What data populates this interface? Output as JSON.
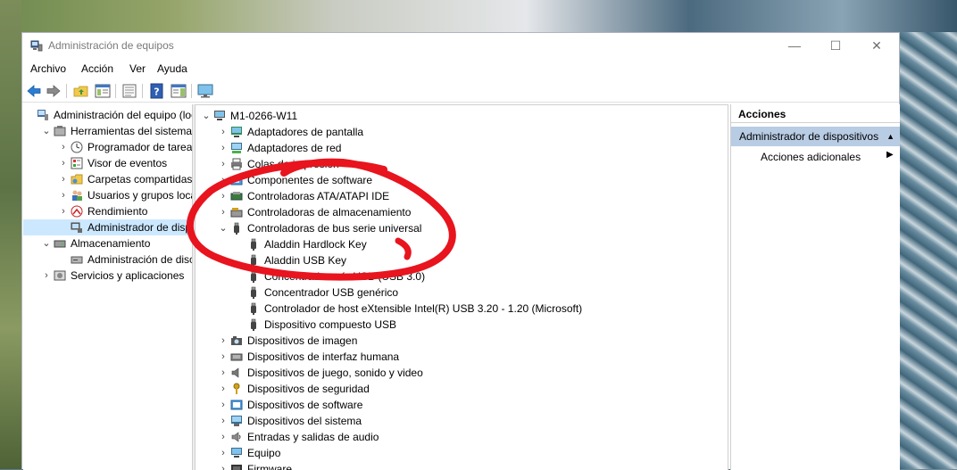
{
  "window": {
    "title": "Administración de equipos",
    "controls": {
      "minimize": "—",
      "maximize": "☐",
      "close": "✕"
    }
  },
  "menu": [
    "Archivo",
    "Acción",
    "Ver",
    "Ayuda"
  ],
  "toolbar": [
    "back-arrow-icon",
    "forward-arrow-icon",
    "up-folder-icon",
    "show-hide-tree-icon",
    "properties-icon",
    "help-icon",
    "action-pane-icon",
    "monitor-icon"
  ],
  "left_tree": [
    {
      "label": "Administración del equipo (local)",
      "level": 0,
      "expander": "",
      "icon": "computer-management-icon"
    },
    {
      "label": "Herramientas del sistema",
      "level": 1,
      "expander": "⌄",
      "icon": "tools-icon"
    },
    {
      "label": "Programador de tareas",
      "level": 2,
      "expander": "›",
      "icon": "clock-icon"
    },
    {
      "label": "Visor de eventos",
      "level": 2,
      "expander": "›",
      "icon": "event-viewer-icon"
    },
    {
      "label": "Carpetas compartidas",
      "level": 2,
      "expander": "›",
      "icon": "shared-folder-icon"
    },
    {
      "label": "Usuarios y grupos locales",
      "level": 2,
      "expander": "›",
      "icon": "users-icon"
    },
    {
      "label": "Rendimiento",
      "level": 2,
      "expander": "›",
      "icon": "performance-icon"
    },
    {
      "label": "Administrador de dispositivos",
      "level": 2,
      "expander": "",
      "icon": "device-manager-icon",
      "selected": true
    },
    {
      "label": "Almacenamiento",
      "level": 1,
      "expander": "⌄",
      "icon": "storage-icon"
    },
    {
      "label": "Administración de discos",
      "level": 2,
      "expander": "",
      "icon": "disk-icon"
    },
    {
      "label": "Servicios y aplicaciones",
      "level": 1,
      "expander": "›",
      "icon": "services-icon"
    }
  ],
  "device_tree": [
    {
      "label": "M1-0266-W11",
      "level": 0,
      "expander": "⌄",
      "icon": "computer-icon"
    },
    {
      "label": "Adaptadores de pantalla",
      "level": 1,
      "expander": "›",
      "icon": "display-adapter-icon"
    },
    {
      "label": "Adaptadores de red",
      "level": 1,
      "expander": "›",
      "icon": "network-adapter-icon"
    },
    {
      "label": "Colas de impresión",
      "level": 1,
      "expander": "›",
      "icon": "printer-icon"
    },
    {
      "label": "Componentes de software",
      "level": 1,
      "expander": "›",
      "icon": "software-component-icon"
    },
    {
      "label": "Controladoras ATA/ATAPI IDE",
      "level": 1,
      "expander": "›",
      "icon": "ide-controller-icon"
    },
    {
      "label": "Controladoras de almacenamiento",
      "level": 1,
      "expander": "›",
      "icon": "storage-controller-icon"
    },
    {
      "label": "Controladoras de bus serie universal",
      "level": 1,
      "expander": "⌄",
      "icon": "usb-icon"
    },
    {
      "label": "Aladdin Hardlock Key",
      "level": 2,
      "expander": "",
      "icon": "usb-icon"
    },
    {
      "label": "Aladdin USB Key",
      "level": 2,
      "expander": "",
      "icon": "usb-icon"
    },
    {
      "label": "Concentrador raíz USB (USB 3.0)",
      "level": 2,
      "expander": "",
      "icon": "usb-icon"
    },
    {
      "label": "Concentrador USB genérico",
      "level": 2,
      "expander": "",
      "icon": "usb-icon"
    },
    {
      "label": "Controlador de host eXtensible Intel(R) USB 3.20 - 1.20 (Microsoft)",
      "level": 2,
      "expander": "",
      "icon": "usb-icon"
    },
    {
      "label": "Dispositivo compuesto USB",
      "level": 2,
      "expander": "",
      "icon": "usb-icon"
    },
    {
      "label": "Dispositivos de imagen",
      "level": 1,
      "expander": "›",
      "icon": "camera-icon"
    },
    {
      "label": "Dispositivos de interfaz humana",
      "level": 1,
      "expander": "›",
      "icon": "hid-icon"
    },
    {
      "label": "Dispositivos de juego, sonido y video",
      "level": 1,
      "expander": "›",
      "icon": "speaker-icon"
    },
    {
      "label": "Dispositivos de seguridad",
      "level": 1,
      "expander": "›",
      "icon": "security-key-icon"
    },
    {
      "label": "Dispositivos de software",
      "level": 1,
      "expander": "›",
      "icon": "software-device-icon"
    },
    {
      "label": "Dispositivos del sistema",
      "level": 1,
      "expander": "›",
      "icon": "system-device-icon"
    },
    {
      "label": "Entradas y salidas de audio",
      "level": 1,
      "expander": "›",
      "icon": "audio-io-icon"
    },
    {
      "label": "Equipo",
      "level": 1,
      "expander": "›",
      "icon": "monitor-icon"
    },
    {
      "label": "Firmware",
      "level": 1,
      "expander": "›",
      "icon": "firmware-icon"
    }
  ],
  "actions": {
    "header": "Acciones",
    "section": "Administrador de dispositivos",
    "more": "Acciones adicionales"
  },
  "colors": {
    "selection": "#cce8ff",
    "action_section": "#b8cce4",
    "annotation": "#e8141e"
  }
}
